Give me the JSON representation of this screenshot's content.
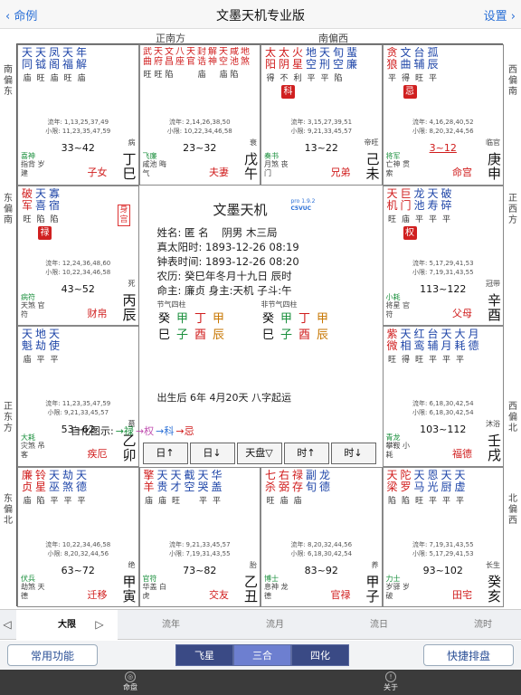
{
  "nav": {
    "back": "命例",
    "title": "文墨天机专业版",
    "settings": "设置"
  },
  "directions": {
    "top": [
      "正南方",
      "南偏西"
    ],
    "bottom": [
      "北偏东",
      "正北方"
    ],
    "left": [
      "南偏东",
      "东偏南",
      "正东方",
      "东偏北"
    ],
    "right": [
      "西偏南",
      "正西方",
      "西偏北",
      "北偏西"
    ]
  },
  "cells": [
    {
      "stars": [
        [
          "天同",
          "庙",
          0
        ],
        [
          "天钺",
          "旺",
          0
        ],
        [
          "凤阁",
          "庙",
          0
        ],
        [
          "天福",
          "旺",
          0
        ],
        [
          "年解",
          "庙",
          0
        ]
      ],
      "flow1": "流年: 1,13,25,37,49",
      "flow2": "小限: 11,23,35,47,59",
      "bl1": "喜神",
      "bl2": "指背 岁建",
      "range": "33~42",
      "palace": "子女",
      "stage": "病",
      "gz": "丁巳"
    },
    {
      "small": true,
      "stars": [
        [
          "武曲",
          "旺",
          1
        ],
        [
          "天府",
          "旺",
          1
        ],
        [
          "文昌",
          "陷",
          1
        ],
        [
          "八座",
          "",
          1
        ],
        [
          "天官",
          "",
          1
        ],
        [
          "封诰",
          "庙",
          1
        ],
        [
          "解神",
          "",
          1
        ],
        [
          "天空",
          "庙",
          1
        ],
        [
          "咸池",
          "陷",
          1
        ],
        [
          "地煞",
          "",
          1
        ]
      ],
      "flow1": "流年: 2,14,26,38,50",
      "flow2": "小限: 10,22,34,46,58",
      "bl1": "飞廉",
      "bl2": "咸池 晦气",
      "range": "23~32",
      "palace": "夫妻",
      "stage": "衰",
      "gz": "戊午"
    },
    {
      "stars": [
        [
          "太阳",
          "得",
          1
        ],
        [
          "太阴",
          "不",
          1
        ],
        [
          "火星",
          "利",
          1
        ],
        [
          "地空",
          "平",
          0
        ],
        [
          "天刑",
          "平",
          0
        ],
        [
          "旬空",
          "陷",
          0
        ],
        [
          "蜚廉",
          "",
          0
        ]
      ],
      "trans": "科",
      "flow1": "流年: 3,15,27,39,51",
      "flow2": "小限: 9,21,33,45,57",
      "bl1": "奏书",
      "bl2": "月煞 丧门",
      "range": "13~22",
      "palace": "兄弟",
      "stage": "帝旺",
      "gz": "己未"
    },
    {
      "stars": [
        [
          "贪狼",
          "平",
          1
        ],
        [
          "文曲",
          "得",
          0
        ],
        [
          "台辅",
          "旺",
          0
        ],
        [
          "孤辰",
          "平",
          0
        ]
      ],
      "trans": "忌",
      "flow1": "流年: 4,16,28,40,52",
      "flow2": "小限: 8,20,32,44,56",
      "bl1": "将军",
      "bl2": "亡神 贯索",
      "range": "3~12",
      "palace": "命宫",
      "stage": "临官",
      "gz": "庚申",
      "range_red": true
    },
    {
      "stars": [
        [
          "破军",
          "旺",
          1
        ],
        [
          "天喜",
          "陷",
          0
        ],
        [
          "寡宿",
          "陷",
          0
        ]
      ],
      "trans": "禄",
      "flow1": "流年: 12,24,36,48,60",
      "flow2": "小限: 10,22,34,46,58",
      "bl1": "病符",
      "bl2": "天煞 官符",
      "range": "43~52",
      "palace": "财帛",
      "stage": "死",
      "gz": "丙辰",
      "shen": "身宫"
    },
    {
      "stars": [
        [
          "天机",
          "旺",
          1
        ],
        [
          "巨门",
          "庙",
          1
        ],
        [
          "龙池",
          "平",
          0
        ],
        [
          "天寿",
          "平",
          0
        ],
        [
          "破碎",
          "平",
          0
        ]
      ],
      "trans": "权",
      "flow1": "流年: 5,17,29,41,53",
      "flow2": "小限: 7,19,31,43,55",
      "bl1": "小耗",
      "bl2": "将星 官符",
      "range": "113~122",
      "palace": "父母",
      "stage": "冠带",
      "gz": "辛酉"
    },
    {
      "stars": [
        [
          "天魁",
          "庙",
          0
        ],
        [
          "地劫",
          "平",
          0
        ],
        [
          "天使",
          "平",
          0
        ]
      ],
      "flow1": "流年: 11,23,35,47,59",
      "flow2": "小限: 9,21,33,45,57",
      "bl1": "大耗",
      "bl2": "灾煞 吊客",
      "range": "53~62",
      "palace": "疾厄",
      "stage": "墓",
      "gz": "乙卯"
    },
    {
      "stars": [
        [
          "紫微",
          "旺",
          1
        ],
        [
          "天相",
          "得",
          0
        ],
        [
          "红鸾",
          "旺",
          0
        ],
        [
          "台辅",
          "平",
          0
        ],
        [
          "天月",
          "平",
          0
        ],
        [
          "大耗",
          "平",
          0
        ],
        [
          "月德",
          "",
          0
        ]
      ],
      "flow1": "流年: 6,18,30,42,54",
      "flow2": "小限: 6,18,30,42,54",
      "bl1": "青龙",
      "bl2": "攀鞍 小耗",
      "range": "103~112",
      "palace": "福德",
      "stage": "沐浴",
      "gz": "壬戌"
    },
    {
      "stars": [
        [
          "廉贞",
          "庙",
          1
        ],
        [
          "铃星",
          "陷",
          1
        ],
        [
          "天巫",
          "平",
          0
        ],
        [
          "劫煞",
          "平",
          0
        ],
        [
          "天德",
          "平",
          0
        ]
      ],
      "flow1": "流年: 10,22,34,46,58",
      "flow2": "小限: 8,20,32,44,56",
      "bl1": "伏兵",
      "bl2": "劫煞 天德",
      "range": "63~72",
      "palace": "迁移",
      "stage": "绝",
      "gz": "甲寅"
    },
    {
      "stars": [
        [
          "擎羊",
          "庙",
          1
        ],
        [
          "天贵",
          "庙",
          0
        ],
        [
          "天才",
          "旺",
          0
        ],
        [
          "截空",
          "",
          0
        ],
        [
          "天哭",
          "平",
          0
        ],
        [
          "华盖",
          "平",
          0
        ]
      ],
      "flow1": "流年: 9,21,33,45,57",
      "flow2": "小限: 7,19,31,43,55",
      "bl1": "官符",
      "bl2": "华盖 白虎",
      "range": "73~82",
      "palace": "交友",
      "stage": "胎",
      "gz": "乙丑"
    },
    {
      "stars": [
        [
          "七杀",
          "旺",
          1
        ],
        [
          "右弼",
          "庙",
          1
        ],
        [
          "禄存",
          "庙",
          1
        ],
        [
          "副旬",
          "",
          0
        ],
        [
          "龙德",
          "",
          0
        ]
      ],
      "flow1": "流年: 8,20,32,44,56",
      "flow2": "小限: 6,18,30,42,54",
      "bl1": "博士",
      "bl2": "息神 龙德",
      "range": "83~92",
      "palace": "官禄",
      "stage": "养",
      "gz": "甲子"
    },
    {
      "stars": [
        [
          "天梁",
          "陷",
          1
        ],
        [
          "陀罗",
          "陷",
          1
        ],
        [
          "天马",
          "旺",
          0
        ],
        [
          "恩光",
          "平",
          0
        ],
        [
          "天厨",
          "平",
          0
        ],
        [
          "天虚",
          "平",
          0
        ]
      ],
      "flow1": "流年: 7,19,31,43,55",
      "flow2": "小限: 5,17,29,41,53",
      "bl1": "力士",
      "bl2": "岁驿 岁破",
      "range": "93~102",
      "palace": "田宅",
      "stage": "长生",
      "gz": "癸亥"
    }
  ],
  "center": {
    "title": "文墨天机",
    "pro": "pro 1.9.2",
    "code": "C5VUC",
    "info": "姓名: 匿 名    阴男 木三局\n真太阳时: 1893-12-26 08:19\n钟表时间: 1893-12-26 08:20\n农历: 癸巳年冬月十九日 辰时\n命主: 廉贞 身主:天机 子斗:午",
    "plabel1": "节气四柱",
    "plabel2": "非节气四柱",
    "pillars1": [
      [
        "癸",
        "巳"
      ],
      [
        "甲",
        "子"
      ],
      [
        "丁",
        "酉"
      ],
      [
        "甲",
        "辰"
      ]
    ],
    "pillars2": [
      [
        "癸",
        "巳"
      ],
      [
        "甲",
        "子"
      ],
      [
        "丁",
        "酉"
      ],
      [
        "甲",
        "辰"
      ]
    ],
    "footer": "出生后 6年 4月20天 八字起运",
    "buttons": [
      "日↑",
      "日↓",
      "天盘▽",
      "时↑",
      "时↓"
    ]
  },
  "legend": {
    "label": "自化图示:",
    "items": [
      "→禄",
      "→权",
      "→科",
      "→忌"
    ]
  },
  "tabs": [
    "大限",
    "流年",
    "流月",
    "流日",
    "流时"
  ],
  "buttons": {
    "common": "常用功能",
    "feixing": "飞星",
    "sanhe": "三合",
    "sihua": "四化",
    "quick": "快捷排盘"
  },
  "tabbar": {
    "chart": "命盘",
    "about": "关于"
  }
}
